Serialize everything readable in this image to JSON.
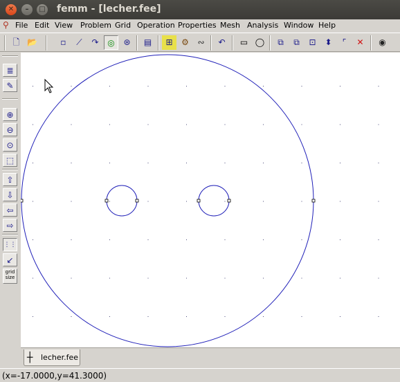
{
  "window": {
    "title": "femm - [lecher.fee]",
    "close_glyph": "✕",
    "min_glyph": "–",
    "max_glyph": "□"
  },
  "menu": {
    "items": [
      "File",
      "Edit",
      "View",
      "Problem",
      "Grid",
      "Operation",
      "Properties",
      "Mesh",
      "Analysis",
      "Window",
      "Help"
    ]
  },
  "toolbar": {
    "buttons": [
      {
        "name": "new-file-icon",
        "glyph": "🗋"
      },
      {
        "name": "open-folder-icon",
        "glyph": "📂"
      },
      {
        "name": "node-mode-icon",
        "glyph": "▫"
      },
      {
        "name": "segment-mode-icon",
        "glyph": "⟋"
      },
      {
        "name": "arc-segment-mode-icon",
        "glyph": "↷"
      },
      {
        "name": "block-label-mode-icon",
        "glyph": "◎",
        "pressed": true
      },
      {
        "name": "group-mode-icon",
        "glyph": "⊛"
      },
      {
        "name": "problem-definition-icon",
        "glyph": "▤"
      },
      {
        "name": "mesh-generate-icon",
        "glyph": "⊞"
      },
      {
        "name": "run-analysis-icon",
        "glyph": "⚙"
      },
      {
        "name": "view-results-icon",
        "glyph": "∾"
      },
      {
        "name": "undo-icon",
        "glyph": "↶"
      },
      {
        "name": "select-window-icon",
        "glyph": "▭"
      },
      {
        "name": "select-radius-icon",
        "glyph": "◯"
      },
      {
        "name": "copy-icon",
        "glyph": "⧉"
      },
      {
        "name": "move-icon",
        "glyph": "⧉"
      },
      {
        "name": "scale-icon",
        "glyph": "⊡"
      },
      {
        "name": "mirror-icon",
        "glyph": "⬍"
      },
      {
        "name": "fillet-icon",
        "glyph": "⌜"
      },
      {
        "name": "delete-icon",
        "glyph": "✕"
      },
      {
        "name": "create-open-boundary-icon",
        "glyph": "◉"
      }
    ]
  },
  "lefttoolbar": {
    "buttons": [
      {
        "name": "show-names-icon",
        "glyph": "≣"
      },
      {
        "name": "edit-props-icon",
        "glyph": "✎"
      },
      {
        "name": "zoom-in-icon",
        "glyph": "⊕"
      },
      {
        "name": "zoom-out-icon",
        "glyph": "⊖"
      },
      {
        "name": "zoom-natural-icon",
        "glyph": "⊙"
      },
      {
        "name": "zoom-window-icon",
        "glyph": "⬚"
      },
      {
        "name": "pan-up-icon",
        "glyph": "⇧"
      },
      {
        "name": "pan-down-icon",
        "glyph": "⇩"
      },
      {
        "name": "pan-left-icon",
        "glyph": "⇦"
      },
      {
        "name": "pan-right-icon",
        "glyph": "⇨"
      },
      {
        "name": "show-grid-icon",
        "glyph": "⋮⋮",
        "pressed": true
      },
      {
        "name": "snap-grid-icon",
        "glyph": "↙"
      }
    ],
    "grid_size_label": "grid\nsize"
  },
  "tab": {
    "label": "lecher.fee",
    "icon": "┼"
  },
  "status": {
    "text": "(x=-17.0000,y=41.3000)"
  },
  "colors": {
    "geometry": "#1f1fb8",
    "grid_dot": "#4a4a7a",
    "node": "#000000"
  }
}
